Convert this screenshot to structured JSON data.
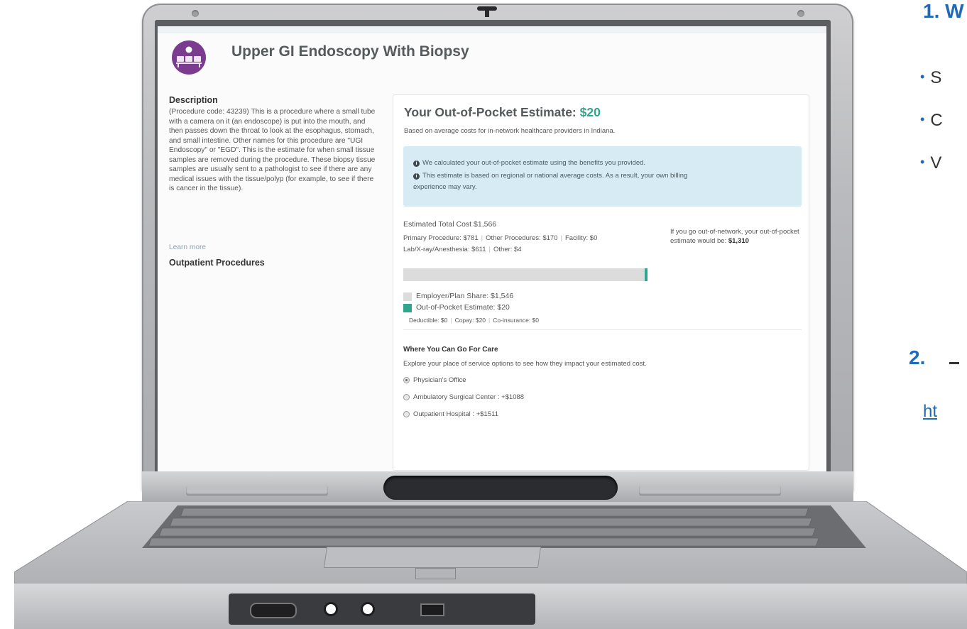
{
  "procedure": {
    "title": "Upper GI Endoscopy With Biopsy",
    "description_heading": "Description",
    "description": "(Procedure code: 43239) This is a procedure where a small tube with a camera on it (an endoscope) is put into the mouth, and then passes down the throat to look at the esophagus, stomach, and small intestine. Other names for this procedure are \"UGI Endoscopy\" or \"EGD\". This is the estimate for when small tissue samples are removed during the procedure. These biopsy tissue samples are usually sent to a pathologist to see if there are any medical issues with the tissue/polyp (for example, to see if there is cancer in the tissue).",
    "learn_more": "Learn more",
    "category": "Outpatient Procedures",
    "icon": "waiting-room-icon"
  },
  "estimate": {
    "title_prefix": "Your Out-of-Pocket Estimate: ",
    "amount": "$20",
    "subtitle": "Based on average costs for in-network healthcare providers in Indiana.",
    "notes": [
      "We calculated your out-of-pocket estimate using the benefits you provided.",
      "This estimate is based on regional or national average costs. As a result, your own billing",
      "experience may vary."
    ],
    "total_label": "Estimated Total Cost",
    "total_value": "$1,566",
    "breakdown": [
      "Primary Procedure: $781",
      "Other Procedures: $170",
      "Facility: $0",
      "Lab/X-ray/Anesthesia: $611",
      "Other: $4"
    ],
    "oon_text": "If you go out-of-network, your out-of-pocket estimate would be:",
    "oon_amount": "$1,310",
    "bar": {
      "employer_share": 1546,
      "out_of_pocket": 20,
      "employer_color": "#dcdcdc",
      "oop_color": "#2fa58e"
    },
    "legend": [
      {
        "label": "Employer/Plan Share: $1,546",
        "color": "#dcdcdc"
      },
      {
        "label": "Out-of-Pocket Estimate: $20",
        "color": "#2fa58e"
      }
    ],
    "cost_share": [
      "Deductible: $0",
      "Copay: $20",
      "Co-insurance: $0"
    ]
  },
  "care": {
    "heading": "Where You Can Go For Care",
    "subtitle": "Explore your place of service options to see how they impact your estimated cost.",
    "options": [
      {
        "label": "Physician's Office",
        "selected": true
      },
      {
        "label": "Ambulatory Surgical Center : +$1088",
        "selected": false
      },
      {
        "label": "Outpatient Hospital : +$1511",
        "selected": false
      }
    ]
  },
  "slide": {
    "heading1": "1. W",
    "bullets": [
      "S",
      "C",
      "V"
    ],
    "heading2": "2.",
    "link": "ht"
  }
}
